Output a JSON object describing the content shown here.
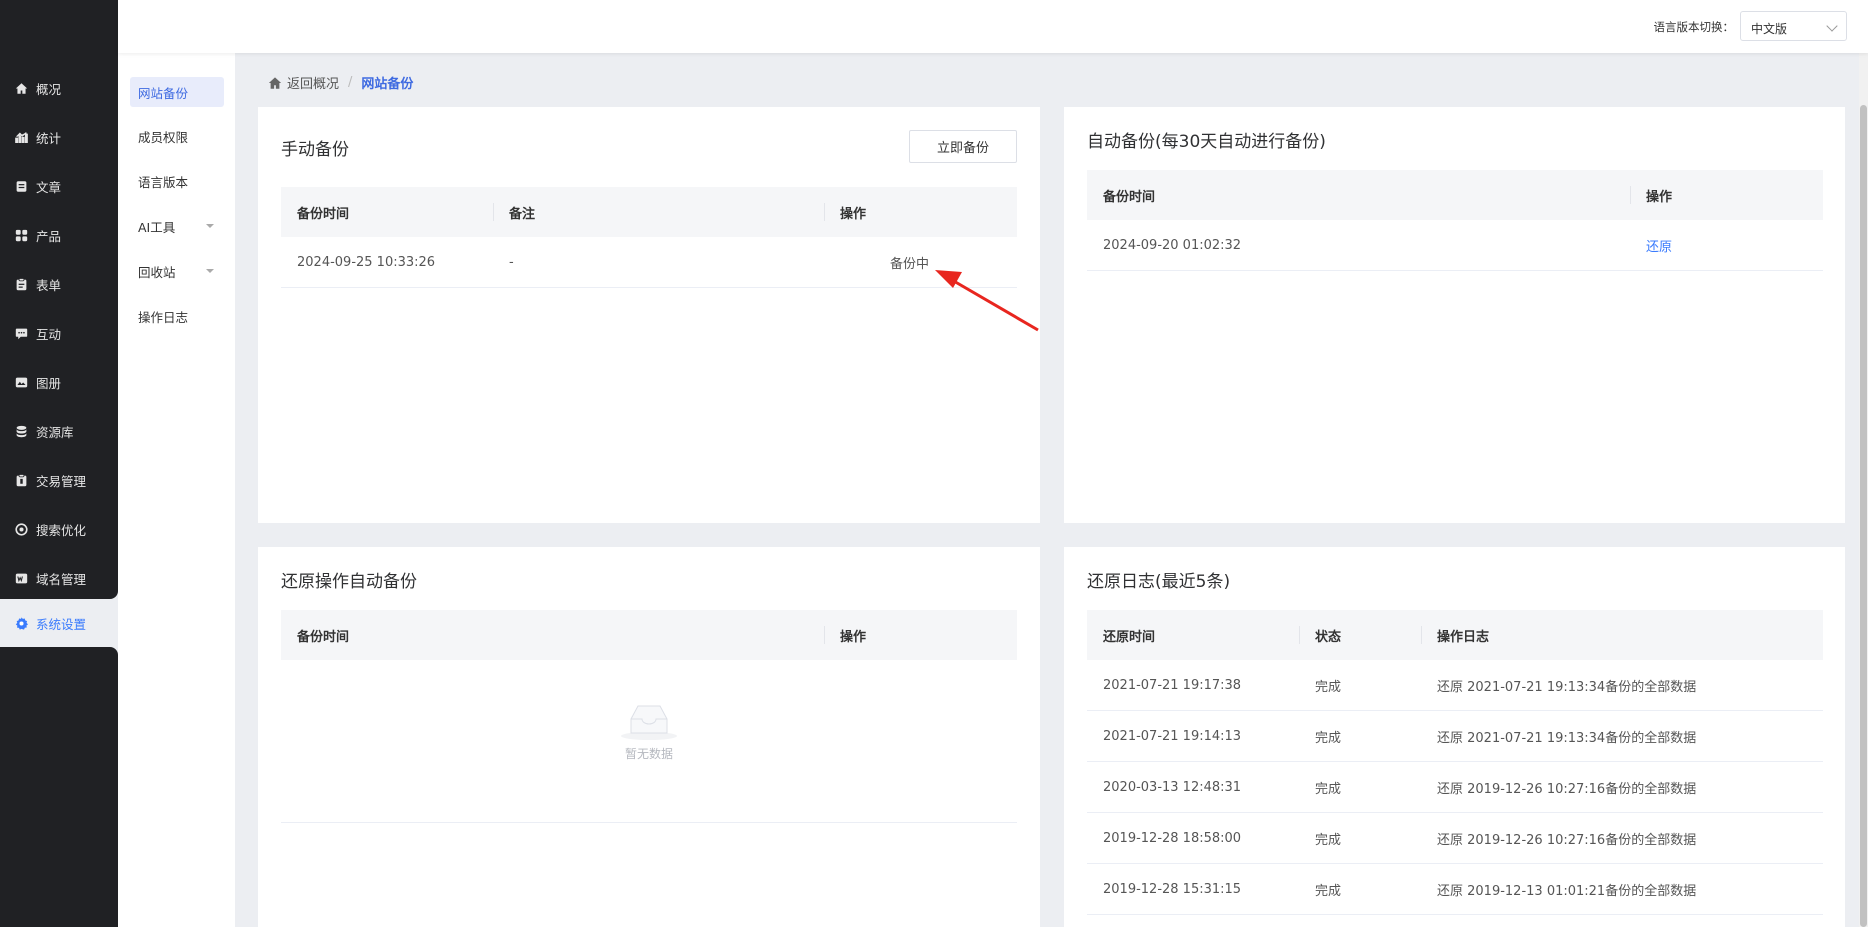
{
  "header": {
    "lang_label": "语言版本切换：",
    "lang_value": "中文版"
  },
  "sidebar": {
    "items": [
      {
        "label": "概况",
        "icon": "home-icon"
      },
      {
        "label": "统计",
        "icon": "stats-icon"
      },
      {
        "label": "文章",
        "icon": "article-icon"
      },
      {
        "label": "产品",
        "icon": "product-icon"
      },
      {
        "label": "表单",
        "icon": "form-icon"
      },
      {
        "label": "互动",
        "icon": "chat-icon"
      },
      {
        "label": "图册",
        "icon": "album-icon"
      },
      {
        "label": "资源库",
        "icon": "database-icon"
      },
      {
        "label": "交易管理",
        "icon": "trade-icon"
      },
      {
        "label": "搜索优化",
        "icon": "seo-icon"
      },
      {
        "label": "域名管理",
        "icon": "domain-icon"
      },
      {
        "label": "系统设置",
        "icon": "gear-icon"
      }
    ],
    "active_color": "#3a7bfd"
  },
  "subnav": {
    "items": [
      {
        "label": "网站备份"
      },
      {
        "label": "成员权限"
      },
      {
        "label": "语言版本"
      },
      {
        "label": "AI工具"
      },
      {
        "label": "回收站"
      },
      {
        "label": "操作日志"
      }
    ]
  },
  "breadcrumb": {
    "home": "返回概况",
    "separator": "/",
    "current": "网站备份"
  },
  "manual_backup": {
    "title": "手动备份",
    "button": "立即备份",
    "columns": [
      "备份时间",
      "备注",
      "操作"
    ],
    "rows": [
      {
        "time": "2024-09-25 10:33:26",
        "note": "-",
        "action": "备份中"
      }
    ]
  },
  "auto_backup": {
    "title": "自动备份(每30天自动进行备份)",
    "columns": [
      "备份时间",
      "操作"
    ],
    "rows": [
      {
        "time": "2024-09-20 01:02:32",
        "action": "还原"
      }
    ]
  },
  "restore_auto_backup": {
    "title": "还原操作自动备份",
    "columns": [
      "备份时间",
      "操作"
    ],
    "empty_text": "暂无数据"
  },
  "restore_log": {
    "title": "还原日志(最近5条)",
    "columns": [
      "还原时间",
      "状态",
      "操作日志"
    ],
    "rows": [
      {
        "time": "2021-07-21 19:17:38",
        "status": "完成",
        "log": "还原 2021-07-21 19:13:34备份的全部数据"
      },
      {
        "time": "2021-07-21 19:14:13",
        "status": "完成",
        "log": "还原 2021-07-21 19:13:34备份的全部数据"
      },
      {
        "time": "2020-03-13 12:48:31",
        "status": "完成",
        "log": "还原 2019-12-26 10:27:16备份的全部数据"
      },
      {
        "time": "2019-12-28 18:58:00",
        "status": "完成",
        "log": "还原 2019-12-26 10:27:16备份的全部数据"
      },
      {
        "time": "2019-12-28 15:31:15",
        "status": "完成",
        "log": "还原 2019-12-13 01:01:21备份的全部数据"
      }
    ]
  },
  "colors": {
    "accent": "#3e6ae1",
    "link": "#3a7bfd",
    "sidebar_bg": "#202124",
    "annotation_arrow": "#e8261f"
  }
}
